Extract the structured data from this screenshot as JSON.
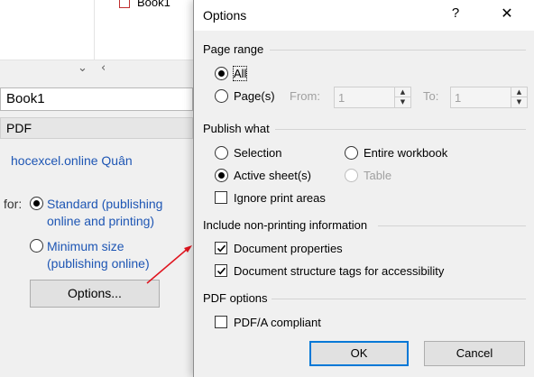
{
  "background": {
    "file_name": "Book1",
    "file_name_field": "Book1",
    "save_as_type": "PDF",
    "author_link": "hocexcel.online Quân",
    "optimize_label": "for:",
    "optimize_options": [
      {
        "label_line1": "Standard (publishing",
        "label_line2": "online and printing)",
        "selected": true
      },
      {
        "label_line1": "Minimum size",
        "label_line2": "(publishing online)",
        "selected": false
      }
    ],
    "options_button": "Options..."
  },
  "dialog": {
    "title": "Options",
    "help_label": "?",
    "close_label": "✕",
    "page_range": {
      "heading": "Page range",
      "all_label": "All",
      "pages_label": "Page(s)",
      "from_label": "From:",
      "from_value": "1",
      "to_label": "To:",
      "to_value": "1",
      "selected": "all"
    },
    "publish_what": {
      "heading": "Publish what",
      "selection_label": "Selection",
      "entire_workbook_label": "Entire workbook",
      "active_sheets_label": "Active sheet(s)",
      "table_label": "Table",
      "ignore_print_areas_label": "Ignore print areas",
      "ignore_print_areas_checked": false,
      "selected": "active_sheets"
    },
    "non_printing": {
      "heading": "Include non-printing information",
      "document_properties_label": "Document properties",
      "document_properties_checked": true,
      "structure_tags_label": "Document structure tags for accessibility",
      "structure_tags_checked": true
    },
    "pdf_options": {
      "heading": "PDF options",
      "pdfa_label": "PDF/A compliant",
      "pdfa_checked": false
    },
    "ok_label": "OK",
    "cancel_label": "Cancel"
  },
  "colors": {
    "link": "#1e56b4",
    "annotation_arrow": "#e0141e",
    "default_button_border": "#0078d7"
  }
}
